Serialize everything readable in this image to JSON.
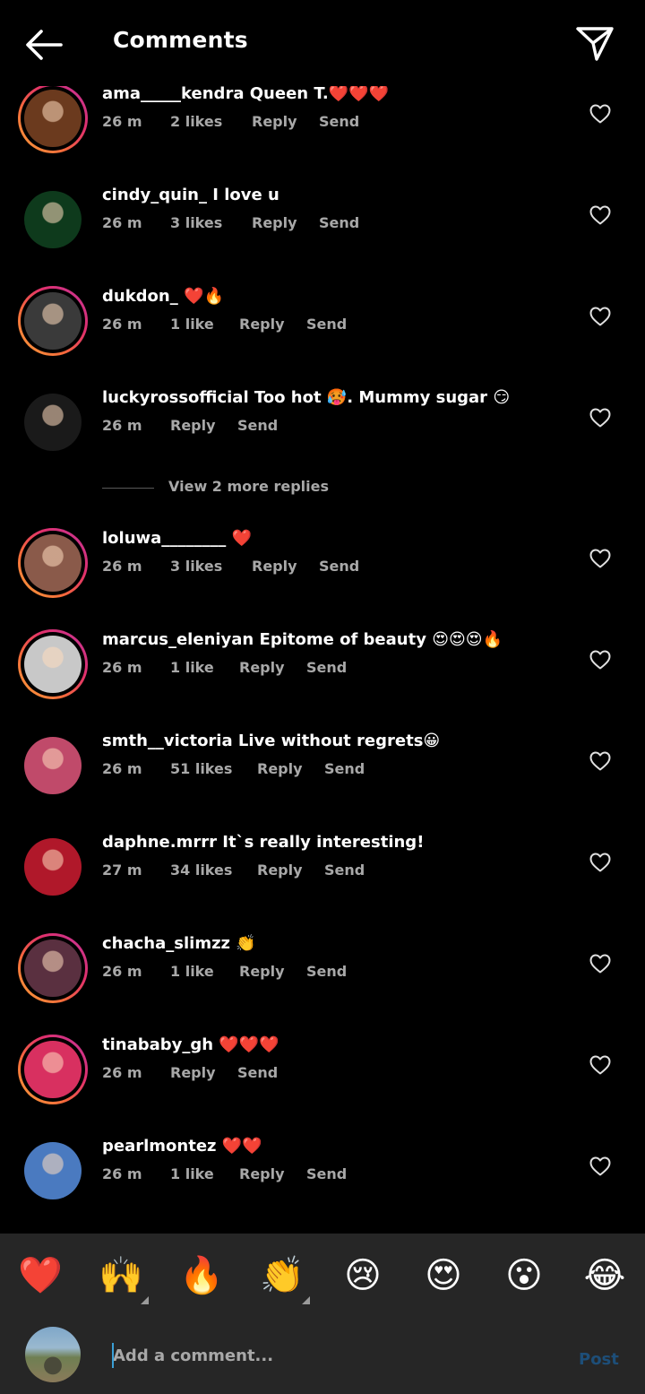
{
  "header": {
    "title": "Comments"
  },
  "comments": [
    {
      "username": "ama_____kendra",
      "text": "Queen T.❤️❤️❤️",
      "time": "26 m",
      "likes": "2 likes",
      "reply": "Reply",
      "send": "Send",
      "avatar_color": "#6b3a1e",
      "ring": true
    },
    {
      "username": "cindy_quin_",
      "text": "I love u",
      "time": "26 m",
      "likes": "3 likes",
      "reply": "Reply",
      "send": "Send",
      "avatar_color": "#0e3a1c",
      "ring": false
    },
    {
      "username": "dukdon_",
      "text": "❤️🔥",
      "time": "26 m",
      "likes": "1 like",
      "reply": "Reply",
      "send": "Send",
      "avatar_color": "#3a3a3a",
      "ring": true
    },
    {
      "username": "luckyrossofficial",
      "text": "Too hot 🥵. Mummy sugar 😏",
      "time": "26 m",
      "likes": "",
      "reply": "Reply",
      "send": "Send",
      "avatar_color": "#1a1a1a",
      "ring": false
    },
    {
      "username": "loluwa________",
      "text": "❤️",
      "time": "26 m",
      "likes": "3 likes",
      "reply": "Reply",
      "send": "Send",
      "avatar_color": "#8a5a4a",
      "ring": true
    },
    {
      "username": "marcus_eleniyan",
      "text": "Epitome of beauty 😍😍😍🔥",
      "time": "26 m",
      "likes": "1 like",
      "reply": "Reply",
      "send": "Send",
      "avatar_color": "#c8c8c8",
      "ring": true
    },
    {
      "username": "smth__victoria",
      "text": "Live without regrets😀",
      "time": "26 m",
      "likes": "51 likes",
      "reply": "Reply",
      "send": "Send",
      "avatar_color": "#c04a6a",
      "ring": false
    },
    {
      "username": "daphne.mrrr",
      "text": "It`s really interesting!",
      "time": "27 m",
      "likes": "34 likes",
      "reply": "Reply",
      "send": "Send",
      "avatar_color": "#b0182a",
      "ring": false
    },
    {
      "username": "chacha_slimzz",
      "text": "👏",
      "time": "26 m",
      "likes": "1 like",
      "reply": "Reply",
      "send": "Send",
      "avatar_color": "#5a3040",
      "ring": true
    },
    {
      "username": "tinababy_gh",
      "text": "❤️❤️❤️",
      "time": "26 m",
      "likes": "",
      "reply": "Reply",
      "send": "Send",
      "avatar_color": "#d83060",
      "ring": true
    },
    {
      "username": "pearlmontez",
      "text": "❤️❤️",
      "time": "26 m",
      "likes": "1 like",
      "reply": "Reply",
      "send": "Send",
      "avatar_color": "#4a7ac0",
      "ring": false
    }
  ],
  "view_more": {
    "label": "View 2 more replies"
  },
  "emoji_bar": [
    "❤️",
    "🙌",
    "🔥",
    "👏",
    "😢",
    "😍",
    "😮",
    "😂"
  ],
  "input": {
    "placeholder": "Add a comment...",
    "post_label": "Post"
  }
}
